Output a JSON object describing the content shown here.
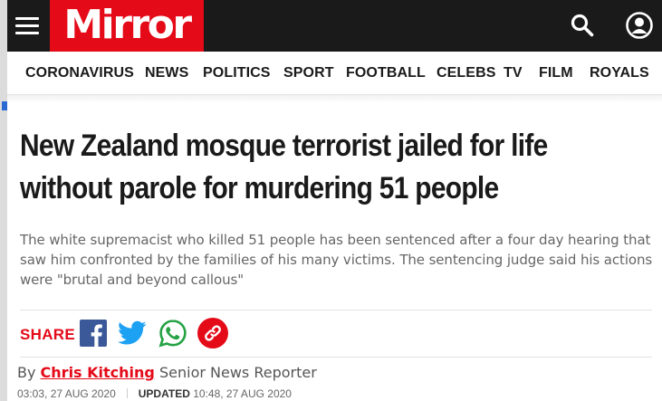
{
  "brand": {
    "logo_text": "Mirror",
    "logo_color": "#e40a18",
    "bar_color": "#1a1a1a"
  },
  "header": {
    "menu_icon": "hamburger-menu-icon",
    "search_icon": "search-icon",
    "account_icon": "user-account-icon"
  },
  "nav": {
    "items": [
      "CORONAVIRUS",
      "NEWS",
      "POLITICS",
      "SPORT",
      "FOOTBALL",
      "CELEBS",
      "TV",
      "FILM",
      "ROYALS"
    ]
  },
  "article": {
    "headline": "New Zealand mosque terrorist jailed for life without parole for murdering 51 people",
    "standfirst": "The white supremacist who killed 51 people has been sentenced after a four day hearing that saw him confronted by the families of his many victims. The sentencing judge said his actions were \"brutal and beyond callous\"",
    "share_label": "SHARE",
    "share_icons": [
      "facebook-icon",
      "twitter-icon",
      "whatsapp-icon",
      "copy-link-icon"
    ],
    "byline_prefix": "By",
    "author": "Chris Kitching",
    "author_role": "Senior News Reporter",
    "published": "03:03, 27 AUG 2020",
    "updated_label": "UPDATED",
    "updated": "10:48, 27 AUG 2020"
  }
}
